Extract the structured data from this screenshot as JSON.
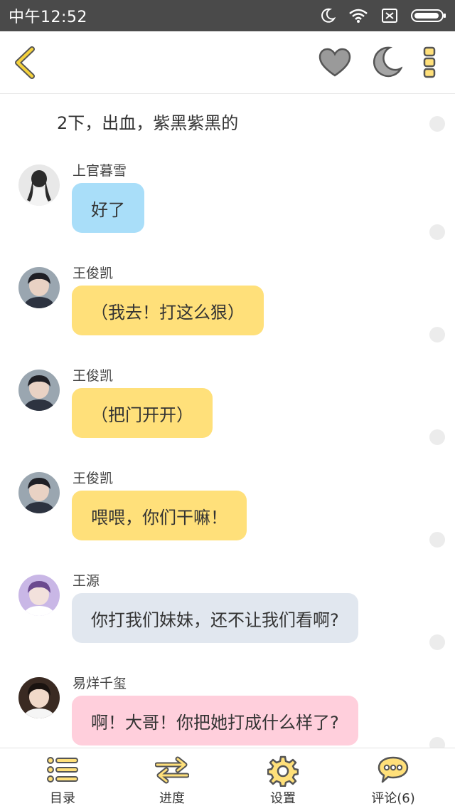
{
  "status_bar": {
    "time": "中午12:52",
    "icons": [
      "moon-icon",
      "wifi-icon",
      "no-sim-icon",
      "battery-icon"
    ]
  },
  "nav": {
    "back_icon": "chevron-left-icon",
    "actions": [
      "heart-icon",
      "moon-icon",
      "more-vertical-icon"
    ]
  },
  "colors": {
    "accent": "#f5d23c",
    "bubble_blue": "#a9def9",
    "bubble_yellow": "#ffe07a",
    "bubble_gray": "#e1e7ef",
    "bubble_pink": "#ffcfdc"
  },
  "narration": "2下，出血，紫黑紫黑的",
  "messages": [
    {
      "sender": "上官暮雪",
      "text": "好了"
    },
    {
      "sender": "王俊凯",
      "text": "（我去！打这么狠）"
    },
    {
      "sender": "王俊凯",
      "text": "（把门开开）"
    },
    {
      "sender": "王俊凯",
      "text": "喂喂，你们干嘛！"
    },
    {
      "sender": "王源",
      "text": "你打我们妹妹，还不让我们看啊?"
    },
    {
      "sender": "易烊千玺",
      "text": "啊！大哥！你把她打成什么样了?"
    }
  ],
  "tabs": [
    {
      "label": "目录",
      "icon": "list-icon"
    },
    {
      "label": "进度",
      "icon": "swap-arrows-icon"
    },
    {
      "label": "设置",
      "icon": "gear-icon"
    },
    {
      "label": "评论(6)",
      "icon": "comment-bubble-icon"
    }
  ]
}
